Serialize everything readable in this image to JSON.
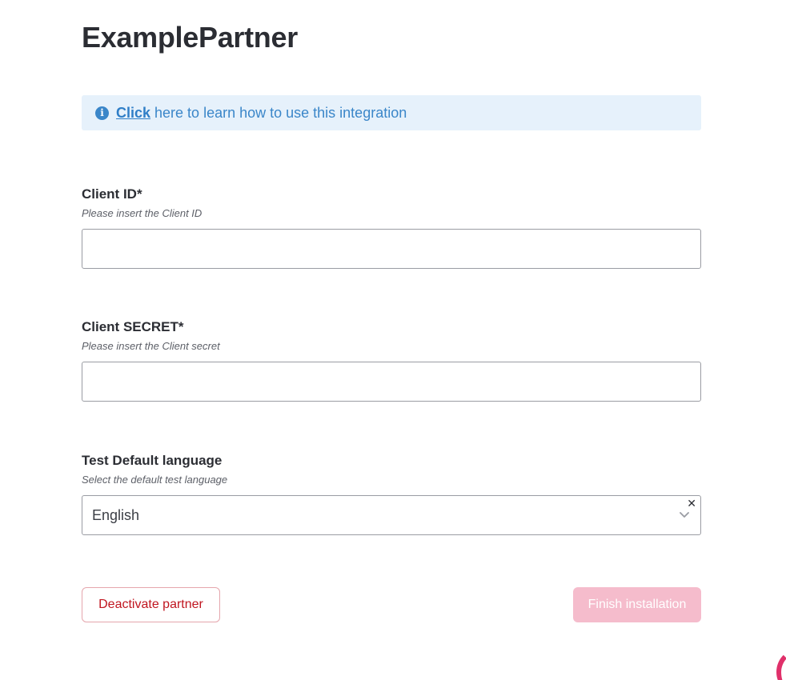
{
  "page": {
    "title": "ExamplePartner"
  },
  "info": {
    "link_text": "Click",
    "text": "here to learn how to use this integration",
    "icon": "info-icon",
    "color": "#3a86c9",
    "background": "#e6f1fb"
  },
  "fields": {
    "client_id": {
      "label": "Client ID*",
      "hint": "Please insert the Client ID",
      "value": ""
    },
    "client_secret": {
      "label": "Client SECRET*",
      "hint": "Please insert the Client secret",
      "value": ""
    },
    "language": {
      "label": "Test Default language",
      "hint": "Select the default test language",
      "selected": "English",
      "clear_icon": "close-icon",
      "chevron_icon": "chevron-down-icon"
    }
  },
  "actions": {
    "deactivate_label": "Deactivate partner",
    "finish_label": "Finish installation",
    "deactivate_color": "#c0151f",
    "finish_color": "#f5bccc"
  }
}
